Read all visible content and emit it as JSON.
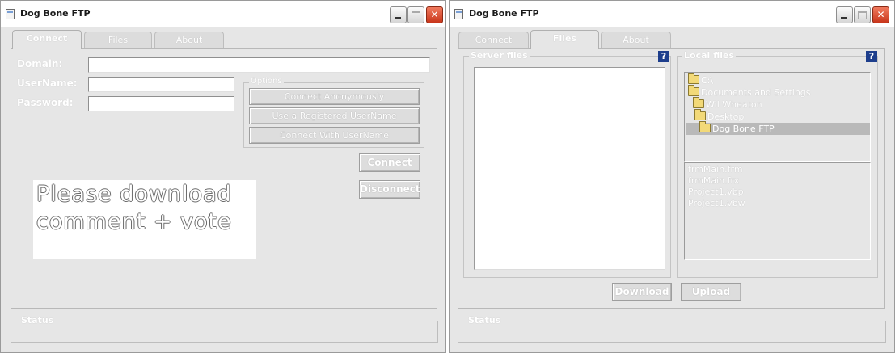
{
  "app_title": "Dog Bone FTP",
  "left_window": {
    "title": "Dog Bone FTP",
    "tabs": [
      {
        "label": "Connect",
        "active": true
      },
      {
        "label": "Files",
        "active": false
      },
      {
        "label": "About",
        "active": false
      }
    ],
    "domain_label": "Domain:",
    "domain_value": "",
    "username_label": "UserName:",
    "username_value": "",
    "password_label": "Password:",
    "password_value": "",
    "options": {
      "title": "Options",
      "buttons": [
        "Connect Anonymously",
        "Use a Registered UserName",
        "Connect With UserName"
      ]
    },
    "connect_button": "Connect",
    "disconnect_button": "Disconnect",
    "promo_text": [
      "Please download",
      "comment + vote"
    ],
    "status_label": "Status"
  },
  "right_window": {
    "title": "Dog Bone FTP",
    "tabs": [
      {
        "label": "Connect",
        "active": false
      },
      {
        "label": "Files",
        "active": true
      },
      {
        "label": "About",
        "active": false
      }
    ],
    "server_files_label": "Server files",
    "local_files_label": "Local files",
    "help_label": "?",
    "folder_tree": [
      {
        "label": "C:\\",
        "level": 0,
        "selected": false
      },
      {
        "label": "Documents and Settings",
        "level": 0,
        "selected": false
      },
      {
        "label": "Wil Wheaton",
        "level": 1,
        "selected": false
      },
      {
        "label": "Desktop",
        "level": 1,
        "selected": false
      },
      {
        "label": "Dog Bone FTP",
        "level": 2,
        "selected": true
      }
    ],
    "local_file_list": [
      "frmMain.frm",
      "frmMain.frx",
      "Project1.vbp",
      "Project1.vbw"
    ],
    "download_button": "Download",
    "upload_button": "Upload",
    "status_label": "Status"
  },
  "colors": {
    "window_bg": "#e6e6e6",
    "close_button": "#d9482a",
    "help_badge": "#1d3e8c",
    "tree_selection": "#b9b9b9"
  },
  "icons": [
    "app-icon",
    "minimize-icon",
    "maximize-icon",
    "close-icon",
    "folder-icon",
    "help-icon"
  ]
}
